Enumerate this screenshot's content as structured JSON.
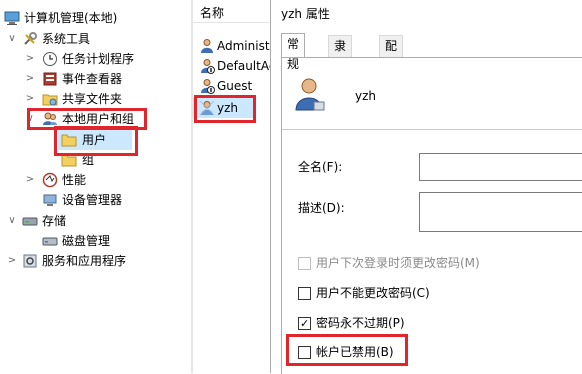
{
  "tree": {
    "root": "计算机管理(本地)",
    "items": [
      {
        "label": "系统工具",
        "chevron": "∨",
        "icon": "tools-icon"
      },
      {
        "label": "任务计划程序",
        "chevron": ">",
        "icon": "clock-icon"
      },
      {
        "label": "事件查看器",
        "chevron": ">",
        "icon": "event-viewer-icon"
      },
      {
        "label": "共享文件夹",
        "chevron": ">",
        "icon": "shared-folder-icon"
      },
      {
        "label": "本地用户和组",
        "chevron": "∨",
        "icon": "users-icon"
      },
      {
        "label": "用户",
        "chevron": "",
        "icon": "folder-icon"
      },
      {
        "label": "组",
        "chevron": "",
        "icon": "folder-icon"
      },
      {
        "label": "性能",
        "chevron": ">",
        "icon": "performance-icon"
      },
      {
        "label": "设备管理器",
        "chevron": "",
        "icon": "device-manager-icon"
      },
      {
        "label": "存储",
        "chevron": "∨",
        "icon": "storage-icon"
      },
      {
        "label": "磁盘管理",
        "chevron": "",
        "icon": "disk-icon"
      },
      {
        "label": "服务和应用程序",
        "chevron": ">",
        "icon": "services-icon"
      }
    ]
  },
  "list": {
    "header": "名称",
    "users": [
      {
        "name": "Administr"
      },
      {
        "name": "DefaultAc"
      },
      {
        "name": "Guest"
      },
      {
        "name": "yzh"
      }
    ]
  },
  "dialog": {
    "title": "yzh 属性",
    "tabs": [
      "常规",
      "隶属于",
      "配置文件"
    ],
    "username": "yzh",
    "fullname_label": "全名(F):",
    "desc_label": "描述(D):",
    "checks": [
      {
        "label": "用户下次登录时须更改密码(M)",
        "checked": false,
        "disabled": true
      },
      {
        "label": "用户不能更改密码(C)",
        "checked": false,
        "disabled": false
      },
      {
        "label": "密码永不过期(P)",
        "checked": true,
        "disabled": false
      },
      {
        "label": "帐户已禁用(B)",
        "checked": false,
        "disabled": false
      }
    ]
  },
  "colors": {
    "highlight": "#e0262b",
    "selection": "#cce8ff",
    "folder": "#f3cf5e"
  }
}
